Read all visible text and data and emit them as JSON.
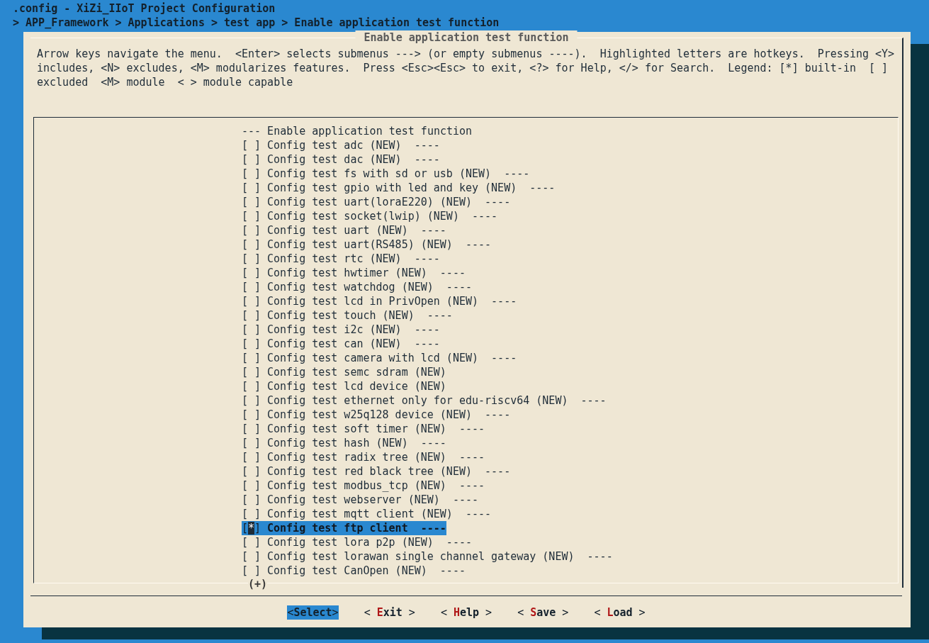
{
  "window": {
    "title": ".config - XiZi_IIoT Project Configuration"
  },
  "breadcrumb": "> APP_Framework > Applications > test app > Enable application test function",
  "dialog": {
    "title": "Enable application test function",
    "help_lines": [
      "Arrow keys navigate the menu.  <Enter> selects submenus ---> (or empty submenus ----).  Highlighted letters are hotkeys.  Pressing <Y>",
      "includes, <N> excludes, <M> modularizes features.  Press <Esc><Esc> to exit, <?> for Help, </> for Search.  Legend: [*] built-in  [ ]",
      "excluded  <M> module  < > module capable"
    ]
  },
  "menu": {
    "items": [
      {
        "kind": "comment",
        "label": "--- Enable application test function",
        "selected": false
      },
      {
        "kind": "bool",
        "box": "[ ]",
        "checked": false,
        "label": "Config test adc (NEW)  ----",
        "selected": false
      },
      {
        "kind": "bool",
        "box": "[ ]",
        "checked": false,
        "label": "Config test dac (NEW)  ----",
        "selected": false
      },
      {
        "kind": "bool",
        "box": "[ ]",
        "checked": false,
        "label": "Config test fs with sd or usb (NEW)  ----",
        "selected": false
      },
      {
        "kind": "bool",
        "box": "[ ]",
        "checked": false,
        "label": "Config test gpio with led and key (NEW)  ----",
        "selected": false
      },
      {
        "kind": "bool",
        "box": "[ ]",
        "checked": false,
        "label": "Config test uart(loraE220) (NEW)  ----",
        "selected": false
      },
      {
        "kind": "bool",
        "box": "[ ]",
        "checked": false,
        "label": "Config test socket(lwip) (NEW)  ----",
        "selected": false
      },
      {
        "kind": "bool",
        "box": "[ ]",
        "checked": false,
        "label": "Config test uart (NEW)  ----",
        "selected": false
      },
      {
        "kind": "bool",
        "box": "[ ]",
        "checked": false,
        "label": "Config test uart(RS485) (NEW)  ----",
        "selected": false
      },
      {
        "kind": "bool",
        "box": "[ ]",
        "checked": false,
        "label": "Config test rtc (NEW)  ----",
        "selected": false
      },
      {
        "kind": "bool",
        "box": "[ ]",
        "checked": false,
        "label": "Config test hwtimer (NEW)  ----",
        "selected": false
      },
      {
        "kind": "bool",
        "box": "[ ]",
        "checked": false,
        "label": "Config test watchdog (NEW)  ----",
        "selected": false
      },
      {
        "kind": "bool",
        "box": "[ ]",
        "checked": false,
        "label": "Config test lcd in PrivOpen (NEW)  ----",
        "selected": false
      },
      {
        "kind": "bool",
        "box": "[ ]",
        "checked": false,
        "label": "Config test touch (NEW)  ----",
        "selected": false
      },
      {
        "kind": "bool",
        "box": "[ ]",
        "checked": false,
        "label": "Config test i2c (NEW)  ----",
        "selected": false
      },
      {
        "kind": "bool",
        "box": "[ ]",
        "checked": false,
        "label": "Config test can (NEW)  ----",
        "selected": false
      },
      {
        "kind": "bool",
        "box": "[ ]",
        "checked": false,
        "label": "Config test camera with lcd (NEW)  ----",
        "selected": false
      },
      {
        "kind": "bool",
        "box": "[ ]",
        "checked": false,
        "label": "Config test semc sdram (NEW)",
        "selected": false
      },
      {
        "kind": "bool",
        "box": "[ ]",
        "checked": false,
        "label": "Config test lcd device (NEW)",
        "selected": false
      },
      {
        "kind": "bool",
        "box": "[ ]",
        "checked": false,
        "label": "Config test ethernet only for edu-riscv64 (NEW)  ----",
        "selected": false
      },
      {
        "kind": "bool",
        "box": "[ ]",
        "checked": false,
        "label": "Config test w25q128 device (NEW)  ----",
        "selected": false
      },
      {
        "kind": "bool",
        "box": "[ ]",
        "checked": false,
        "label": "Config test soft timer (NEW)  ----",
        "selected": false
      },
      {
        "kind": "bool",
        "box": "[ ]",
        "checked": false,
        "label": "Config test hash (NEW)  ----",
        "selected": false
      },
      {
        "kind": "bool",
        "box": "[ ]",
        "checked": false,
        "label": "Config test radix tree (NEW)  ----",
        "selected": false
      },
      {
        "kind": "bool",
        "box": "[ ]",
        "checked": false,
        "label": "Config test red black tree (NEW)  ----",
        "selected": false
      },
      {
        "kind": "bool",
        "box": "[ ]",
        "checked": false,
        "label": "Config test modbus_tcp (NEW)  ----",
        "selected": false
      },
      {
        "kind": "bool",
        "box": "[ ]",
        "checked": false,
        "label": "Config test webserver (NEW)  ----",
        "selected": false
      },
      {
        "kind": "bool",
        "box": "[ ]",
        "checked": false,
        "label": "Config test mqtt client (NEW)  ----",
        "selected": false
      },
      {
        "kind": "bool",
        "box": "[*]",
        "checked": true,
        "label": "Config test ftp client  ----",
        "selected": true
      },
      {
        "kind": "bool",
        "box": "[ ]",
        "checked": false,
        "label": "Config test lora p2p (NEW)  ----",
        "selected": false
      },
      {
        "kind": "bool",
        "box": "[ ]",
        "checked": false,
        "label": "Config test lorawan single channel gateway (NEW)  ----",
        "selected": false
      },
      {
        "kind": "bool",
        "box": "[ ]",
        "checked": false,
        "label": "Config test CanOpen (NEW)  ----",
        "selected": false
      }
    ],
    "more_indicator": "(+)"
  },
  "buttons": [
    {
      "left": "<",
      "hotkey": "S",
      "rest": "elect",
      "right": ">",
      "selected": true
    },
    {
      "left": "< ",
      "hotkey": "E",
      "rest": "xit",
      "right": " >",
      "selected": false
    },
    {
      "left": "< ",
      "hotkey": "H",
      "rest": "elp",
      "right": " >",
      "selected": false
    },
    {
      "left": "< ",
      "hotkey": "S",
      "rest": "ave",
      "right": " >",
      "selected": false
    },
    {
      "left": "< ",
      "hotkey": "L",
      "rest": "oad",
      "right": " >",
      "selected": false
    }
  ]
}
